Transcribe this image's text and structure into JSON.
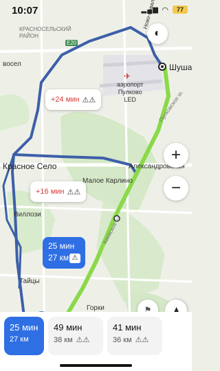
{
  "status": {
    "time": "10:07",
    "battery": "77",
    "signal": "▂▄▆",
    "wifi": "◠"
  },
  "map": {
    "labels": {
      "krasnoselsky": "КРАСНОСЕЛЬСКИЙ\nРАЙОН",
      "e20": "E20",
      "village_top": "Ново-Ковалево",
      "vosel": "восел",
      "shushary": "Шуша",
      "airport": "аэропорт\nПулково\nLED",
      "pulk_highway": "Пулковское ш.",
      "kiev_highway": "Киевское ш.",
      "krasnoe_selo": "Красное Село",
      "aleksandrovskaya": "Александровская",
      "maloe_karlino": "Малое Карлино",
      "villozi": "Виллози",
      "taitsy": "Тайцы",
      "gorki": "Горки"
    },
    "route_colors": {
      "selected": "#2f6fe4",
      "selected_fast": "#8bd94a",
      "alt": "#3d5fa8"
    },
    "traffic_bubbles": [
      {
        "delta": "+24 мин",
        "icon": "road-warning-icon"
      },
      {
        "delta": "+16 мин",
        "icon": "road-warning-icon"
      }
    ],
    "selected_bubble": {
      "time": "25 мин",
      "distance": "27 км",
      "icon": "warning-triangle-icon"
    }
  },
  "controls": {
    "zoom_in": "+",
    "zoom_out": "−",
    "compass": "◐",
    "navigate": "➤"
  },
  "routes": [
    {
      "time": "25 мин",
      "distance": "27 км",
      "selected": true
    },
    {
      "time": "49 мин",
      "distance": "38 км",
      "selected": false
    },
    {
      "time": "41 мин",
      "distance": "36 км",
      "selected": false
    }
  ]
}
